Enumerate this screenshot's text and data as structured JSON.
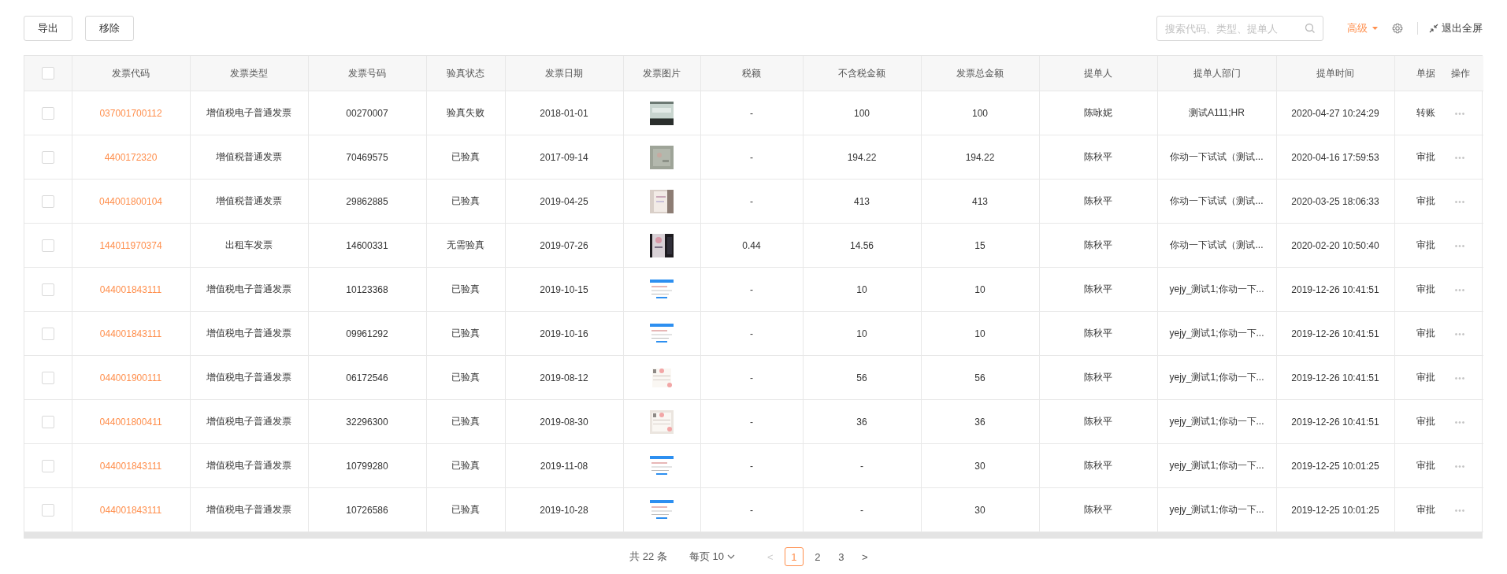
{
  "toolbar": {
    "buttons": [
      "导出",
      "移除"
    ],
    "search": {
      "placeholder": "搜索代码、类型、提单人"
    },
    "advanced": "高级",
    "exit_fullscreen": "退出全屏"
  },
  "table": {
    "select_all": {
      "checked": false
    },
    "columns": [
      "发票代码",
      "发票类型",
      "发票号码",
      "验真状态",
      "发票日期",
      "发票图片",
      "税额",
      "不含税金额",
      "发票总金额",
      "提单人",
      "提单人部门",
      "提单时间",
      "单据",
      "操作"
    ],
    "rows": [
      {
        "checked": false,
        "code": "037001700112",
        "type": "增值税电子普通发票",
        "number": "00270007",
        "verify": "验真失败",
        "date": "2018-01-01",
        "tax": "-",
        "net": "100",
        "total": "100",
        "submitter": "陈咏妮",
        "dept": "测试A111;HR",
        "time": "2020-04-27 10:24:29",
        "doc": "转账",
        "action": "•••"
      },
      {
        "checked": false,
        "code": "4400172320",
        "type": "增值税普通发票",
        "number": "70469575",
        "verify": "已验真",
        "date": "2017-09-14",
        "tax": "-",
        "net": "194.22",
        "total": "194.22",
        "submitter": "陈秋平",
        "dept": "你动一下试试（测试...",
        "time": "2020-04-16 17:59:53",
        "doc": "审批",
        "action": "•••"
      },
      {
        "checked": false,
        "code": "044001800104",
        "type": "增值税普通发票",
        "number": "29862885",
        "verify": "已验真",
        "date": "2019-04-25",
        "tax": "-",
        "net": "413",
        "total": "413",
        "submitter": "陈秋平",
        "dept": "你动一下试试（测试...",
        "time": "2020-03-25 18:06:33",
        "doc": "审批",
        "action": "•••"
      },
      {
        "checked": false,
        "code": "144011970374",
        "type": "出租车发票",
        "number": "14600331",
        "verify": "无需验真",
        "date": "2019-07-26",
        "tax": "0.44",
        "net": "14.56",
        "total": "15",
        "submitter": "陈秋平",
        "dept": "你动一下试试（测试...",
        "time": "2020-02-20 10:50:40",
        "doc": "审批",
        "action": "•••"
      },
      {
        "checked": false,
        "code": "044001843111",
        "type": "增值税电子普通发票",
        "number": "10123368",
        "verify": "已验真",
        "date": "2019-10-15",
        "tax": "-",
        "net": "10",
        "total": "10",
        "submitter": "陈秋平",
        "dept": "yejy_测试1;你动一下...",
        "time": "2019-12-26 10:41:51",
        "doc": "审批",
        "action": "•••"
      },
      {
        "checked": false,
        "code": "044001843111",
        "type": "增值税电子普通发票",
        "number": "09961292",
        "verify": "已验真",
        "date": "2019-10-16",
        "tax": "-",
        "net": "10",
        "total": "10",
        "submitter": "陈秋平",
        "dept": "yejy_测试1;你动一下...",
        "time": "2019-12-26 10:41:51",
        "doc": "审批",
        "action": "•••"
      },
      {
        "checked": false,
        "code": "044001900111",
        "type": "增值税电子普通发票",
        "number": "06172546",
        "verify": "已验真",
        "date": "2019-08-12",
        "tax": "-",
        "net": "56",
        "total": "56",
        "submitter": "陈秋平",
        "dept": "yejy_测试1;你动一下...",
        "time": "2019-12-26 10:41:51",
        "doc": "审批",
        "action": "•••"
      },
      {
        "checked": false,
        "code": "044001800411",
        "type": "增值税电子普通发票",
        "number": "32296300",
        "verify": "已验真",
        "date": "2019-08-30",
        "tax": "-",
        "net": "36",
        "total": "36",
        "submitter": "陈秋平",
        "dept": "yejy_测试1;你动一下...",
        "time": "2019-12-26 10:41:51",
        "doc": "审批",
        "action": "•••"
      },
      {
        "checked": false,
        "code": "044001843111",
        "type": "增值税电子普通发票",
        "number": "10799280",
        "verify": "已验真",
        "date": "2019-11-08",
        "tax": "-",
        "net": "-",
        "total": "30",
        "submitter": "陈秋平",
        "dept": "yejy_测试1;你动一下...",
        "time": "2019-12-25 10:01:25",
        "doc": "审批",
        "action": "•••"
      },
      {
        "checked": false,
        "code": "044001843111",
        "type": "增值税电子普通发票",
        "number": "10726586",
        "verify": "已验真",
        "date": "2019-10-28",
        "tax": "-",
        "net": "-",
        "total": "30",
        "submitter": "陈秋平",
        "dept": "yejy_测试1;你动一下...",
        "time": "2019-12-25 10:01:25",
        "doc": "审批",
        "action": "•••"
      }
    ]
  },
  "pagination": {
    "total": "共 22 条",
    "page_size": "每页 10",
    "prev": "<",
    "pages": [
      {
        "label": "1",
        "selected": true
      },
      {
        "label": "2",
        "selected": false
      },
      {
        "label": "3",
        "selected": false
      }
    ],
    "next": ">"
  }
}
